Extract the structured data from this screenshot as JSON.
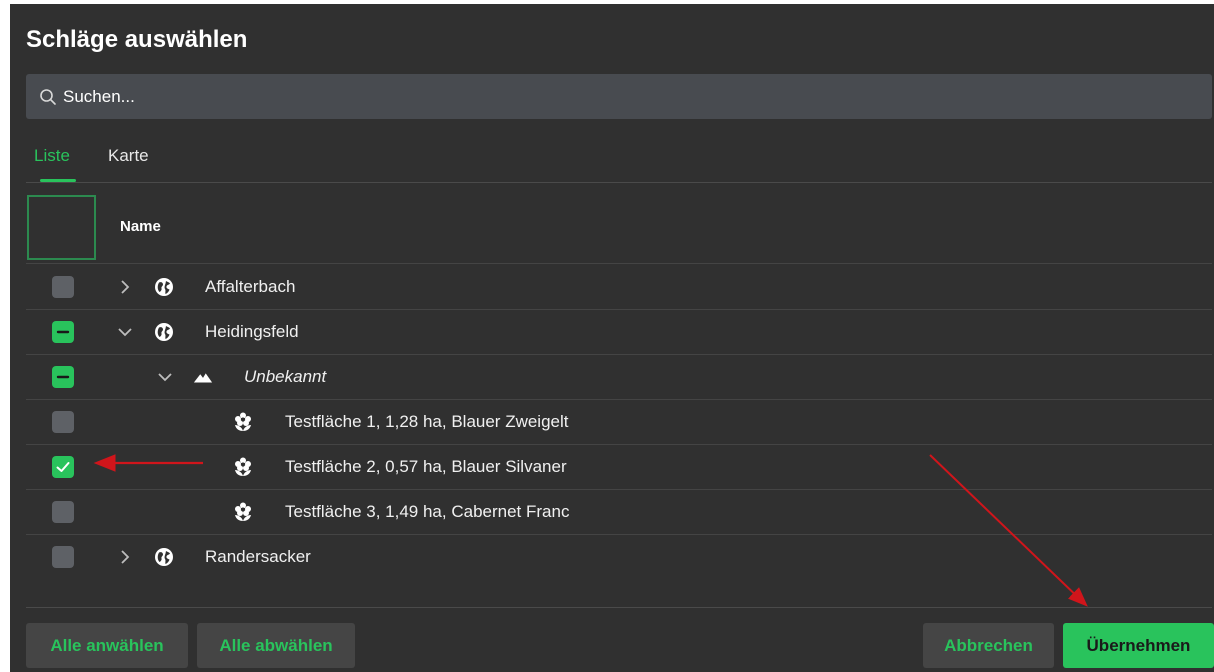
{
  "dialog": {
    "title": "Schläge auswählen"
  },
  "search": {
    "placeholder": "Suchen...",
    "icon": "search-icon"
  },
  "tabs": [
    {
      "label": "Liste",
      "active": true
    },
    {
      "label": "Karte",
      "active": false
    }
  ],
  "table": {
    "column_name": "Name",
    "rows": [
      {
        "label": "Affalterbach",
        "level": 0,
        "icon": "globe-icon",
        "expanded": false,
        "state": "unchecked"
      },
      {
        "label": "Heidingsfeld",
        "level": 0,
        "icon": "globe-icon",
        "expanded": true,
        "state": "partial"
      },
      {
        "label": "Unbekannt",
        "level": 1,
        "icon": "mountain-icon",
        "expanded": true,
        "state": "partial",
        "italic": true
      },
      {
        "label": "Testfläche 1, 1,28 ha, Blauer Zweigelt",
        "level": 2,
        "icon": "flower-icon",
        "state": "unchecked"
      },
      {
        "label": "Testfläche 2, 0,57 ha, Blauer Silvaner",
        "level": 2,
        "icon": "flower-icon",
        "state": "checked"
      },
      {
        "label": "Testfläche 3, 1,49 ha, Cabernet Franc",
        "level": 2,
        "icon": "flower-icon",
        "state": "unchecked"
      },
      {
        "label": "Randersacker",
        "level": 0,
        "icon": "globe-icon",
        "expanded": false,
        "state": "unchecked"
      }
    ]
  },
  "footer": {
    "select_all": "Alle anwählen",
    "deselect_all": "Alle abwählen",
    "cancel": "Abbrechen",
    "apply": "Übernehmen"
  },
  "colors": {
    "accent": "#29c35c",
    "background": "#303030",
    "annotation_arrow": "#d0151b"
  }
}
